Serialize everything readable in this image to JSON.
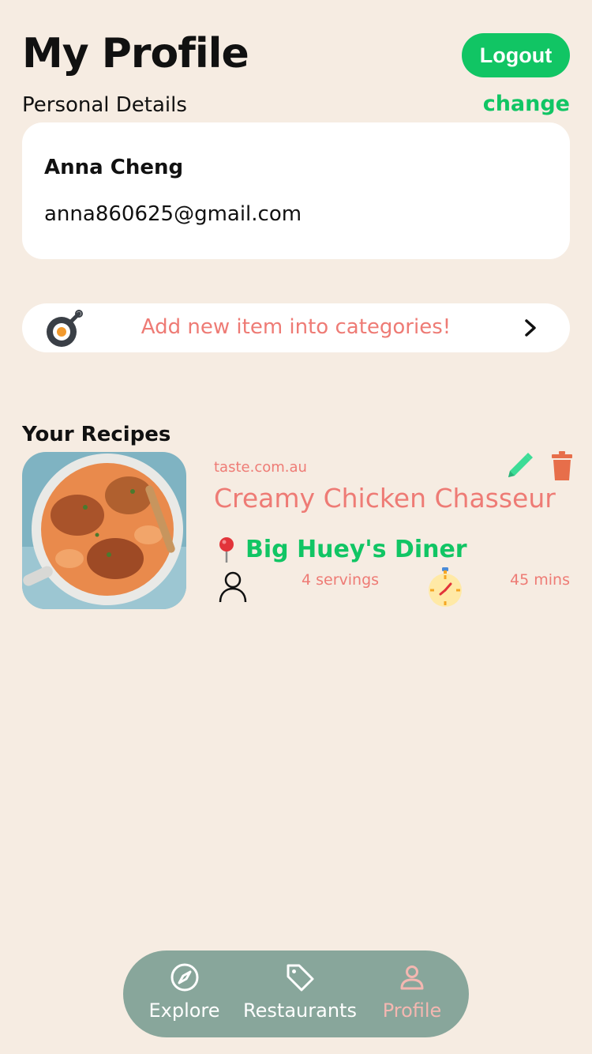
{
  "header": {
    "title": "My Profile",
    "logout_label": "Logout"
  },
  "personal": {
    "section_label": "Personal Details",
    "change_label": "change",
    "name": "Anna Cheng",
    "email": "anna860625@gmail.com"
  },
  "add_item": {
    "label": "Add new item into categories!",
    "icon": "frying-pan-icon"
  },
  "recipes": {
    "heading": "Your Recipes",
    "items": [
      {
        "source": "taste.com.au",
        "title": "Creamy Chicken Chasseur",
        "restaurant": "Big Huey's Diner",
        "servings": "4 servings",
        "time": "45 mins"
      }
    ]
  },
  "nav": {
    "items": [
      {
        "label": "Explore",
        "icon": "compass-icon",
        "active": false
      },
      {
        "label": "Restaurants",
        "icon": "tag-icon",
        "active": false
      },
      {
        "label": "Profile",
        "icon": "person-icon",
        "active": true
      }
    ]
  },
  "colors": {
    "background": "#F6ECE2",
    "accent_green": "#11C564",
    "accent_coral": "#EE7B75",
    "nav_background": "#88A69B",
    "nav_active": "#F4B7B1"
  }
}
